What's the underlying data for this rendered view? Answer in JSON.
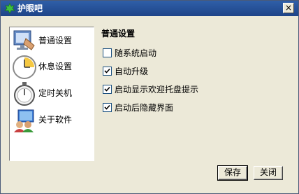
{
  "window": {
    "title": "护眼吧",
    "close_glyph": "×"
  },
  "sidebar": {
    "items": [
      {
        "label": "普通设置",
        "icon": "settings-icon"
      },
      {
        "label": "休息设置",
        "icon": "clock-icon"
      },
      {
        "label": "定时关机",
        "icon": "stopwatch-icon"
      },
      {
        "label": "关于软件",
        "icon": "about-icon"
      }
    ]
  },
  "main": {
    "section_title": "普通设置",
    "options": [
      {
        "label": "随系统启动",
        "checked": false
      },
      {
        "label": "自动升级",
        "checked": true
      },
      {
        "label": "启动显示欢迎托盘提示",
        "checked": true
      },
      {
        "label": "启动后隐藏界面",
        "checked": true
      }
    ]
  },
  "buttons": {
    "save": "保存",
    "close": "关闭"
  }
}
